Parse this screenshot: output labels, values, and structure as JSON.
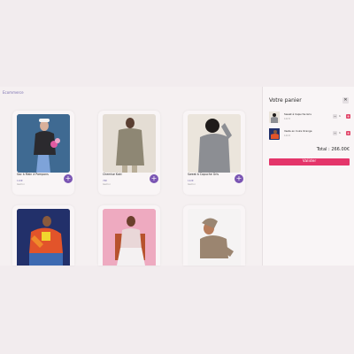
{
  "app": {
    "brand": "Ecommerce"
  },
  "products": [
    {
      "name": "Sac à Main à Pompons",
      "price": "110€",
      "brand": "Gemoi",
      "add_icon": "plus-icon"
    },
    {
      "name": "Chemise Kaki",
      "price": "76€",
      "brand": "Gemoi",
      "add_icon": "plus-icon"
    },
    {
      "name": "Sweat à Capuche Gris",
      "price": "122€",
      "brand": "Gemoi",
      "add_icon": "plus-icon"
    },
    {
      "name": "",
      "price": "",
      "brand": ""
    },
    {
      "name": "",
      "price": "",
      "brand": ""
    },
    {
      "name": "",
      "price": "",
      "brand": ""
    }
  ],
  "cart": {
    "title": "Votre panier",
    "close_icon": "close-icon",
    "items": [
      {
        "name": "Sweat à Capuche Gris",
        "price": "122 €",
        "qty": "1"
      },
      {
        "name": "Veste en Cuire Orange",
        "price": "144 €",
        "qty": "1"
      }
    ],
    "total": "Total : 266.00€",
    "validate_label": "Valider"
  },
  "colors": {
    "accent": "#7a55b3",
    "cta": "#e4356a",
    "background": "#f5f0f1"
  }
}
